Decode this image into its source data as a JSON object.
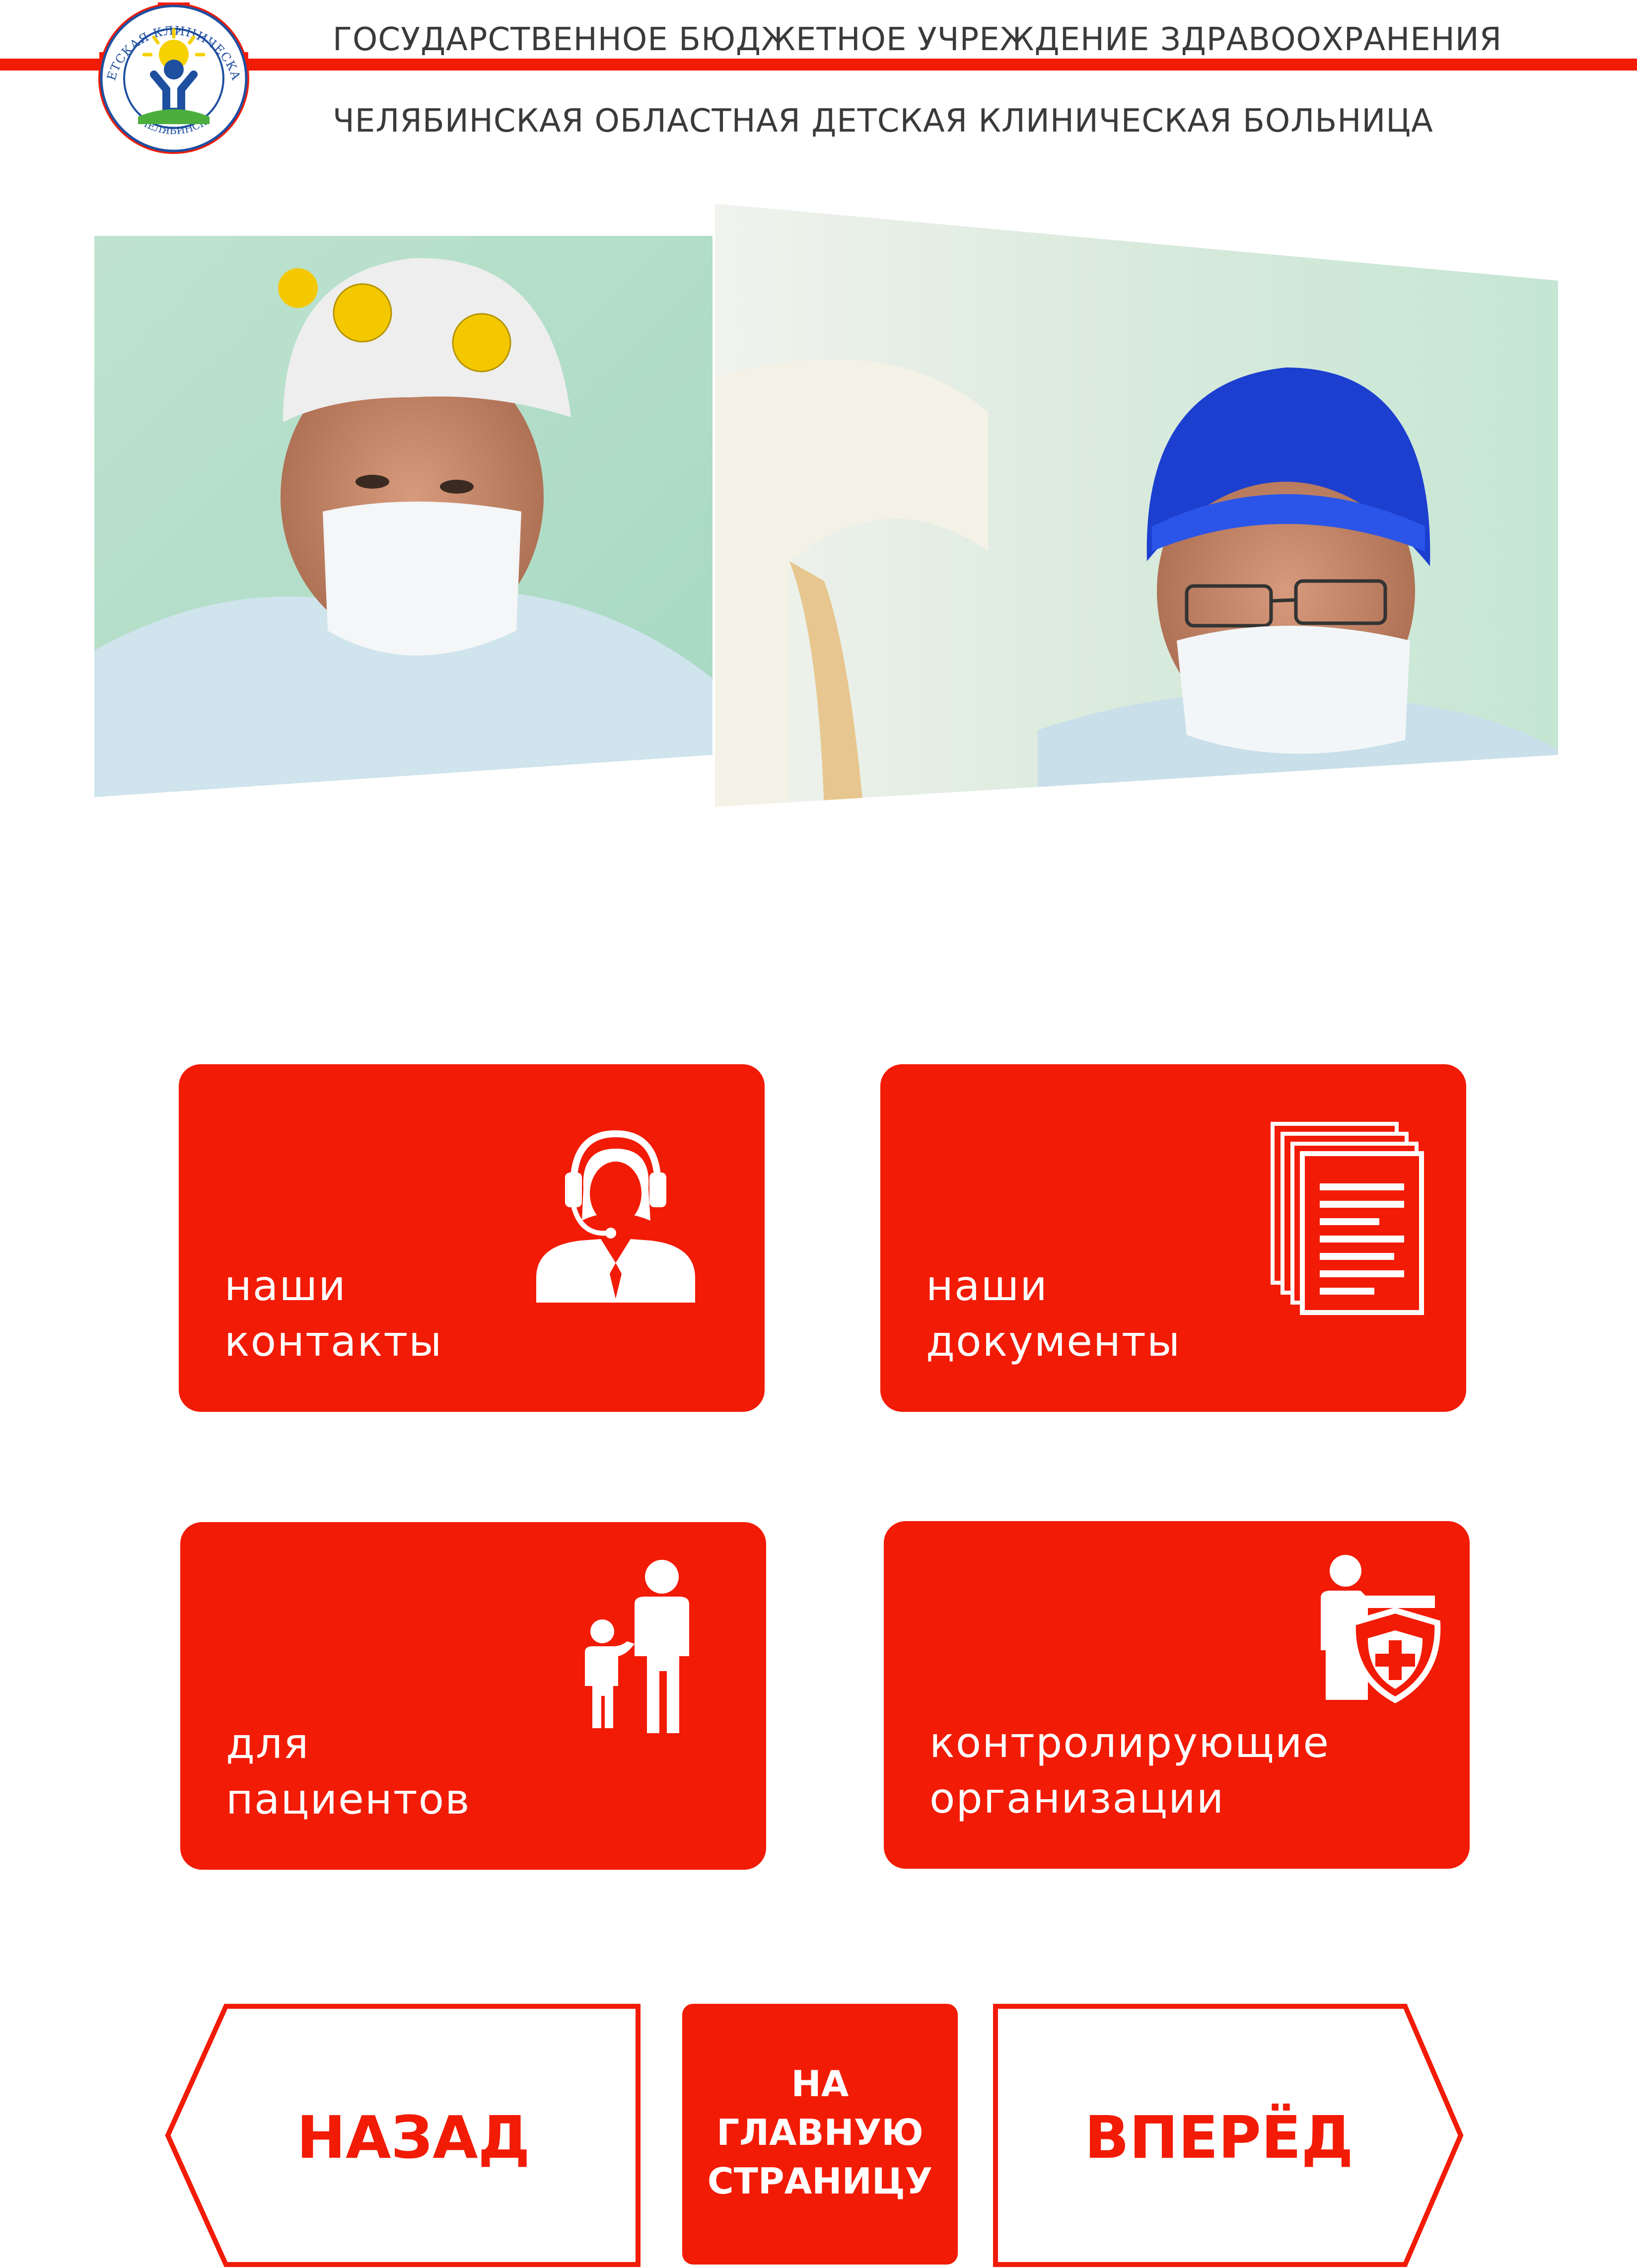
{
  "colors": {
    "brand_red": "#f21b05",
    "text_gray": "#3a3a3a",
    "white": "#ffffff"
  },
  "header": {
    "logo_text_top": "ДЕТСКАЯ КЛИНИЧЕСКАЯ",
    "logo_text_left": "ОБЛАСТНАЯ",
    "logo_text_right": "БОЛЬНИЦА",
    "logo_text_bottom": "ЧЕЛЯБИНСК",
    "line1": "ГОСУДАРСТВЕННОЕ БЮДЖЕТНОЕ УЧРЕЖДЕНИЕ ЗДРАВООХРАНЕНИЯ",
    "line2": "ЧЕЛЯБИНСКАЯ ОБЛАСТНАЯ ДЕТСКАЯ КЛИНИЧЕСКАЯ БОЛЬНИЦА"
  },
  "tiles": [
    {
      "line1": "наши",
      "line2": "контакты",
      "icon": "headset-operator-icon"
    },
    {
      "line1": "наши",
      "line2": "документы",
      "icon": "documents-stack-icon"
    },
    {
      "line1": "для",
      "line2": "пациентов",
      "icon": "parent-child-icon"
    },
    {
      "line1": "контролирующие",
      "line2": "организации",
      "icon": "inspector-shield-icon"
    }
  ],
  "nav": {
    "back_label": "НАЗАД",
    "home_line1": "НА",
    "home_line2": "ГЛАВНУЮ",
    "home_line3": "СТРАНИЦУ",
    "forward_label": "ВПЕРЁД"
  }
}
